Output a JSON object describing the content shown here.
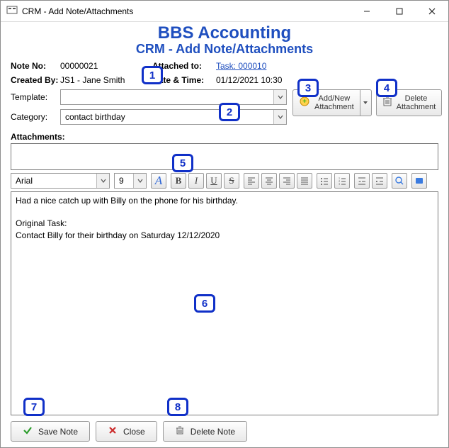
{
  "title": "CRM - Add Note/Attachments",
  "header": {
    "line1": "BBS Accounting",
    "line2": "CRM - Add Note/Attachments"
  },
  "meta": {
    "noteno_label": "Note No:",
    "noteno": "00000021",
    "createdby_label": "Created By:",
    "createdby": "JS1 - Jane Smith",
    "attachedto_label": "Attached to:",
    "attachedto": "Task: 000010",
    "datetime_label": "Date & Time:",
    "datetime": "01/12/2021 10:30"
  },
  "form": {
    "template_label": "Template:",
    "template_value": "",
    "category_label": "Category:",
    "category_value": "contact birthday",
    "attachments_label": "Attachments:"
  },
  "actions": {
    "add_attachment": "Add/New\nAttachment",
    "delete_attachment": "Delete\nAttachment"
  },
  "editor": {
    "font": "Arial",
    "size": "9",
    "text": "Had a nice catch up with Billy on the phone for his birthday.\n\nOriginal Task:\nContact Billy for their birthday on Saturday 12/12/2020"
  },
  "footer": {
    "save": "Save Note",
    "close": "Close",
    "delete": "Delete Note"
  },
  "callouts": {
    "c1": "1",
    "c2": "2",
    "c3": "3",
    "c4": "4",
    "c5": "5",
    "c6": "6",
    "c7": "7",
    "c8": "8"
  }
}
